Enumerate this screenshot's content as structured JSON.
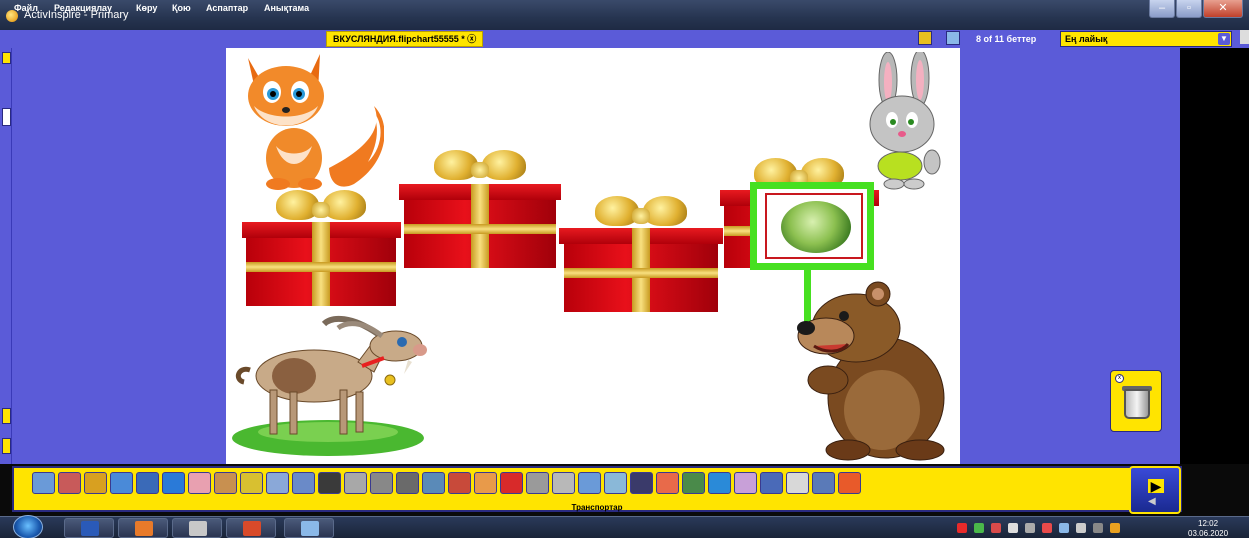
{
  "window": {
    "title": "ActivInspire - Primary"
  },
  "menu": {
    "items": [
      "Файл",
      "Редакциялау",
      "Көру",
      "Қою",
      "Аспаптар",
      "Анықтама"
    ],
    "document_tab": "ВКУСЛЯНДИЯ.flipchart55555 * ⓧ",
    "page_label": "8 of 11 беттер",
    "zoom_value": "Ең лайық"
  },
  "toolbar": {
    "label": "Транспортар"
  },
  "taskbar": {
    "time": "12:02",
    "date": "03.06.2020"
  },
  "colors": {
    "frame": "#5b5bd8",
    "toolbar": "#ffe400",
    "highlight": "#46e020"
  }
}
